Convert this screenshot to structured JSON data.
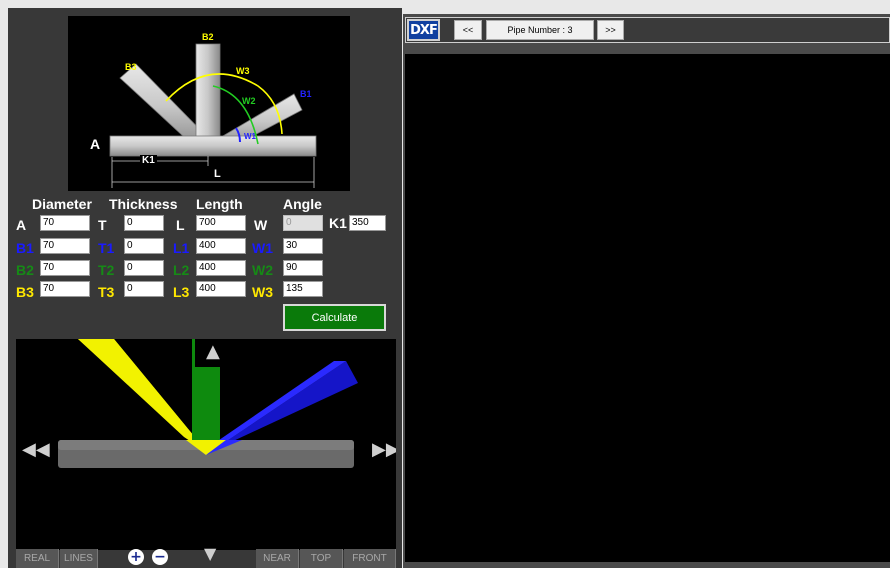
{
  "diagram": {
    "labels": {
      "b2": "B2",
      "b3": "B3",
      "w3": "W3",
      "w2": "W2",
      "b1": "B1",
      "w1": "W1",
      "a": "A",
      "k1": "K1",
      "l": "L"
    }
  },
  "headers": {
    "diameter": "Diameter",
    "thickness": "Thickness",
    "length": "Length",
    "angle": "Angle"
  },
  "rows": [
    {
      "d_label": "A",
      "d_value": "70",
      "t_label": "T",
      "t_value": "0",
      "l_label": "L",
      "l_value": "700",
      "w_label": "W",
      "w_value": "0"
    },
    {
      "d_label": "B1",
      "d_value": "70",
      "t_label": "T1",
      "t_value": "0",
      "l_label": "L1",
      "l_value": "400",
      "w_label": "W1",
      "w_value": "30"
    },
    {
      "d_label": "B2",
      "d_value": "70",
      "t_label": "T2",
      "t_value": "0",
      "l_label": "L2",
      "l_value": "400",
      "w_label": "W2",
      "w_value": "90"
    },
    {
      "d_label": "B3",
      "d_value": "70",
      "t_label": "T3",
      "t_value": "0",
      "l_label": "L3",
      "l_value": "400",
      "w_label": "W3",
      "w_value": "135"
    }
  ],
  "k1": {
    "label": "K1",
    "value": "350"
  },
  "calculate_label": "Calculate",
  "view_buttons": {
    "real": "REAL",
    "lines": "LINES",
    "near": "NEAR",
    "top": "TOP",
    "front": "FRONT"
  },
  "toolbar": {
    "dxf": "DXF",
    "prev": "<<",
    "pipe_number": "Pipe Number : 3",
    "next": ">>"
  },
  "colors": {
    "b1": "#1a1aff",
    "b2": "#168a16",
    "b3": "#ffe800",
    "pipe": "#7a7a7a",
    "button": "#0a7a0a"
  },
  "icons": {
    "up": "arrow-up-icon",
    "down": "arrow-down-icon",
    "left": "arrow-left-icon",
    "right": "arrow-right-icon",
    "zoom_in": "zoom-in-icon",
    "zoom_out": "zoom-out-icon"
  }
}
